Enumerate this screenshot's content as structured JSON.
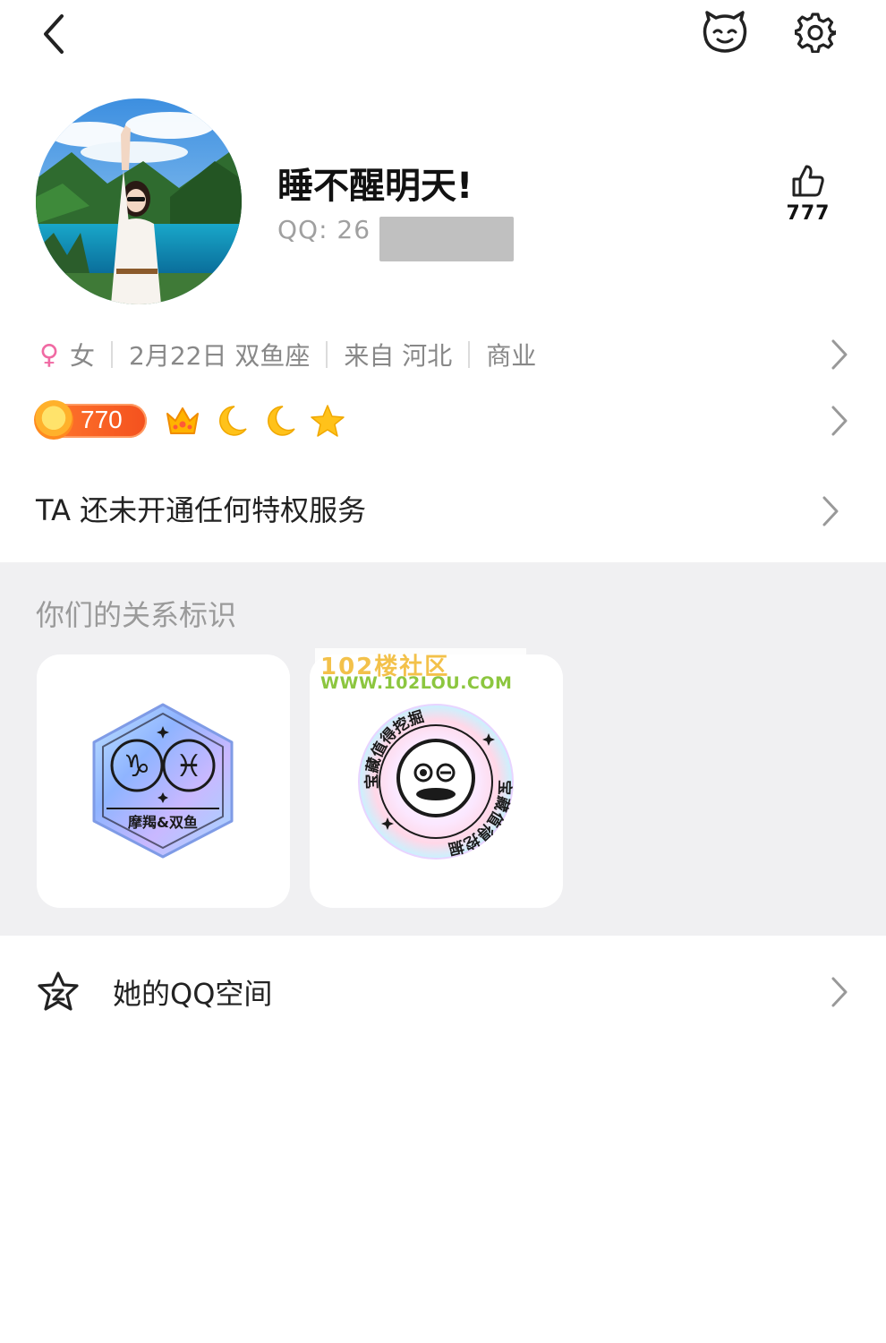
{
  "topbar": {
    "back_icon": "chevron-left-icon",
    "pet_icon": "pet-face-icon",
    "settings_icon": "gear-icon"
  },
  "profile": {
    "nickname": "睡不醒明天!",
    "qq_label": "QQ: 26",
    "likes": "777"
  },
  "info": {
    "gender_symbol": "♀",
    "gender": "女",
    "birthday": "2月22日 双鱼座",
    "location": "来自 河北",
    "industry": "商业"
  },
  "level": {
    "value": "770",
    "badges": [
      "crown-icon",
      "moon-icon",
      "moon-icon",
      "star-icon"
    ]
  },
  "privilege": {
    "text": "TA 还未开通任何特权服务"
  },
  "relationship": {
    "title": "你们的关系标识",
    "cards": [
      {
        "badge_text": "摩羯&双鱼",
        "symbols": [
          "♑",
          "♓"
        ]
      },
      {
        "ring_text_top": "宝藏值得挖掘",
        "ring_text_bottom": "宝藏值得挖掘"
      }
    ],
    "watermark_line1": "102楼社区",
    "watermark_line2": "WWW.102LOU.COM"
  },
  "space": {
    "label": "她的QQ空间"
  },
  "colors": {
    "accent_female": "#f06aa3",
    "level_orange": "#f4511e",
    "section_bg": "#f0f0f2"
  }
}
